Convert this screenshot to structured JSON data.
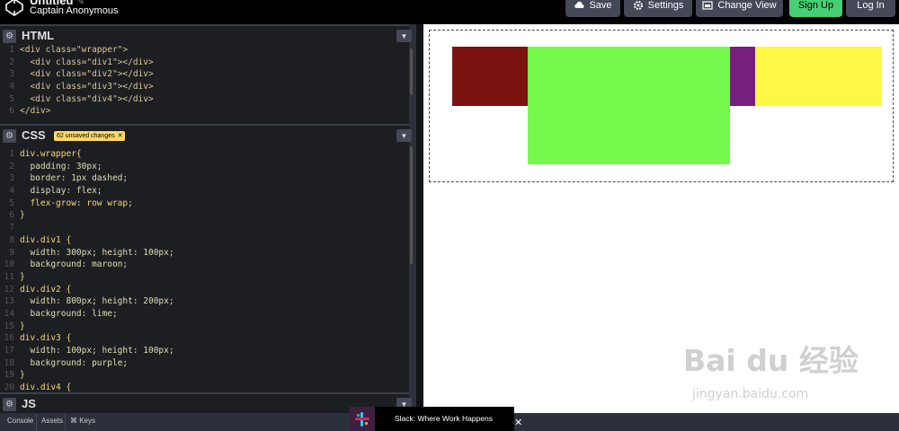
{
  "header": {
    "pen_title": "Untitled",
    "pen_title_edit_icon": "pencil-icon",
    "author": "Captain Anonymous",
    "buttons": {
      "save": "Save",
      "settings": "Settings",
      "change_view": "Change View",
      "sign_up": "Sign Up",
      "log_in": "Log In"
    }
  },
  "panes": {
    "html": {
      "label": "HTML",
      "lines": [
        {
          "n": "1",
          "text": "<div class=\"wrapper\">"
        },
        {
          "n": "2",
          "text": "  <div class=\"div1\"></div>"
        },
        {
          "n": "3",
          "text": "  <div class=\"div2\"></div>"
        },
        {
          "n": "4",
          "text": "  <div class=\"div3\"></div>"
        },
        {
          "n": "5",
          "text": "  <div class=\"div4\"></div>"
        },
        {
          "n": "6",
          "text": "</div>"
        }
      ]
    },
    "css": {
      "label": "CSS",
      "badge": "62 unsaved changes",
      "lines": [
        {
          "n": "1",
          "text": "div.wrapper{"
        },
        {
          "n": "2",
          "text": "  padding: 30px;"
        },
        {
          "n": "3",
          "text": "  border: 1px dashed;"
        },
        {
          "n": "4",
          "text": "  display: flex;"
        },
        {
          "n": "5",
          "text": "  flex-grow: row wrap;"
        },
        {
          "n": "6",
          "text": "}"
        },
        {
          "n": "7",
          "text": ""
        },
        {
          "n": "8",
          "text": "div.div1 {"
        },
        {
          "n": "9",
          "text": "  width: 300px; height: 100px;"
        },
        {
          "n": "10",
          "text": "  background: maroon;"
        },
        {
          "n": "11",
          "text": "}"
        },
        {
          "n": "12",
          "text": "div.div2 {"
        },
        {
          "n": "13",
          "text": "  width: 800px; height: 200px;"
        },
        {
          "n": "14",
          "text": "  background: lime;"
        },
        {
          "n": "15",
          "text": "}"
        },
        {
          "n": "16",
          "text": "div.div3 {"
        },
        {
          "n": "17",
          "text": "  width: 100px; height: 100px;"
        },
        {
          "n": "18",
          "text": "  background: purple;"
        },
        {
          "n": "19",
          "text": "}"
        },
        {
          "n": "20",
          "text": "div.div4 {"
        }
      ]
    },
    "js": {
      "label": "JS"
    }
  },
  "preview": {
    "colors": {
      "div1": "#7b1410",
      "div2": "#76f84c",
      "div3": "#771f7c",
      "div4": "#fdf745"
    }
  },
  "bottom_bar": {
    "console": "Console",
    "assets": "Assets",
    "keys": "⌘ Keys"
  },
  "ad": {
    "text": "Slack: Where Work Happens",
    "close": "✕"
  },
  "watermark": {
    "brand": "Bai du 经验",
    "url": "jingyan.baidu.com"
  }
}
